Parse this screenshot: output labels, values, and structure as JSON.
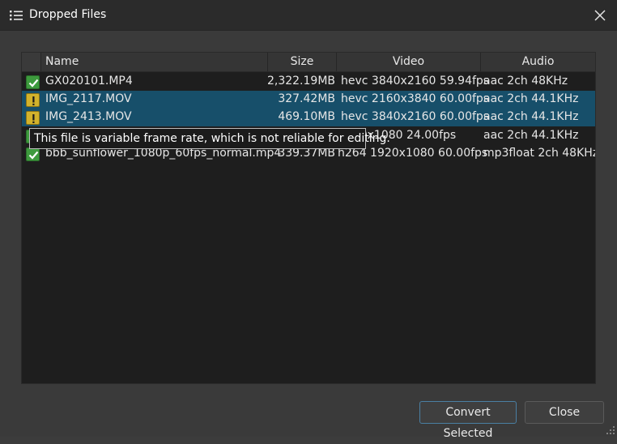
{
  "window": {
    "title": "Dropped Files",
    "title_icon": "list-icon",
    "close_icon": "close-icon"
  },
  "table": {
    "columns": [
      "Name",
      "Size",
      "Video",
      "Audio"
    ],
    "rows": [
      {
        "status": "ok",
        "name": "GX020101.MP4",
        "size": "2,322.19MB",
        "video": "hevc 3840x2160 59.94fps",
        "audio": "aac 2ch 48KHz",
        "selected": false
      },
      {
        "status": "warning",
        "name": "IMG_2117.MOV",
        "size": "327.42MB",
        "video": "hevc 2160x3840 60.00fps",
        "audio": "aac 2ch 44.1KHz",
        "selected": true
      },
      {
        "status": "warning",
        "name": "IMG_2413.MOV",
        "size": "469.10MB",
        "video": "hevc 3840x2160 60.00fps",
        "audio": "aac 2ch 44.1KHz",
        "selected": true
      },
      {
        "status": "ok",
        "name": "",
        "size": "",
        "video": "1920x1080 24.00fps",
        "audio": "aac 2ch 44.1KHz",
        "selected": false
      },
      {
        "status": "ok",
        "name": "bbb_sunflower_1080p_60fps_normal.mp4",
        "size": "339.37MB",
        "video": "h264 1920x1080 60.00fps",
        "audio": "mp3float 2ch 48KHz",
        "selected": false
      }
    ]
  },
  "tooltip": {
    "text": "This file is variable frame rate, which is not reliable for editing."
  },
  "buttons": {
    "convert_label": "Convert Selected",
    "close_label": "Close"
  },
  "colors": {
    "selection": "#174f6a",
    "ok": "#3d9a3d",
    "warning": "#d2b22c",
    "accent_border": "#4a7fa3"
  }
}
